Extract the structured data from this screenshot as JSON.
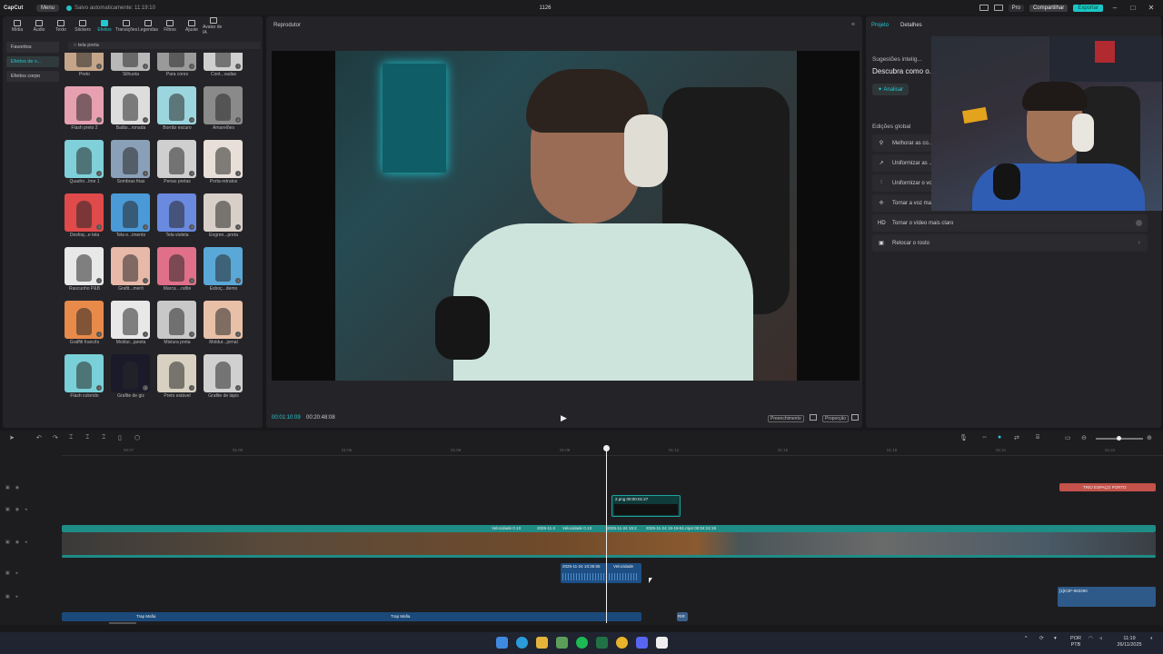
{
  "app": {
    "logo_text": "CapCut",
    "menu_label": "Menu",
    "save_status": "Salvo automaticamente: 11:19:10",
    "project_title": "1126",
    "pro_label": "Pro",
    "share_label": "Compartilhar",
    "export_label": "Exportar",
    "accent_color": "#1bc6c8"
  },
  "toolbar": {
    "tabs": [
      {
        "label": "Mídia",
        "icon": "media-icon"
      },
      {
        "label": "Áudio",
        "icon": "audio-icon"
      },
      {
        "label": "Texto",
        "icon": "text-icon"
      },
      {
        "label": "Stickers",
        "icon": "sticker-icon"
      },
      {
        "label": "Efeitos",
        "icon": "effects-icon",
        "active": true
      },
      {
        "label": "Transições",
        "icon": "transition-icon"
      },
      {
        "label": "Legendas",
        "icon": "captions-icon"
      },
      {
        "label": "Filtros",
        "icon": "filter-icon"
      },
      {
        "label": "Ajuste",
        "icon": "adjust-icon"
      },
      {
        "label": "Avatar de IA",
        "icon": "ai-avatar-icon"
      }
    ]
  },
  "left_panel": {
    "categories": [
      "Favoritos",
      "Efeitos de v...",
      "Efeitos corpo"
    ],
    "search_tag": "tela preta",
    "effects": [
      "Preto",
      "Silhueta",
      "Para cores",
      "Cont...vadas",
      "Flash preto 2",
      "Balão...ronada",
      "Borrão escuro",
      "Amarelões",
      "Quadro...lme 1",
      "Sombras frias",
      "Penas pretas",
      "Porta-retratos",
      "Desfoq...e tela",
      "Tela e...imento",
      "Tela violeta",
      "Engren...preta",
      "Rascunho P&B",
      "Grafit...merô",
      "Marca ...rafite",
      "Esboç...demo",
      "Graffiti francês",
      "Moldur...janela",
      "Mistura preta",
      "Moldur...jornal",
      "Flash colorido",
      "Grafite de giz",
      "Preto estável",
      "Grafite de lápis"
    ]
  },
  "player": {
    "title": "Reprodutor",
    "current_time": "00:01:10:09",
    "total_time": "00:20:48:08",
    "fill_label": "Preenchimento",
    "ratio_label": "Proporção"
  },
  "right_panel": {
    "tab_project": "Projeto",
    "tab_details": "Detalhes",
    "suggest_title": "Sugestões intelig...",
    "suggest_head": "Descubra como o...",
    "analyze_label": "Analisar",
    "global_title": "Edições global",
    "items": [
      {
        "label": "Melhorar as co...",
        "icon": "wand-icon"
      },
      {
        "label": "Uniformizar as ...",
        "icon": "brush-icon"
      },
      {
        "label": "Uniformizar o vo...",
        "icon": "equalizer-icon"
      },
      {
        "label": "Tornar a voz ma...",
        "icon": "sparkle-icon"
      },
      {
        "label": "Tornar o vídeo mais claro",
        "icon": "hd-icon"
      },
      {
        "label": "Retocar o rosto",
        "icon": "face-icon"
      }
    ]
  },
  "timeline": {
    "ruler": [
      "00:07",
      "01:00",
      "01:05",
      "01:06",
      "01:09",
      "01:12",
      "01:15",
      "01:18",
      "01:21",
      "01:24"
    ],
    "clips": {
      "title_overlay": "TRIO ESPAÇO PORTO",
      "sticker_clip": "2.png  00:00:01:27",
      "speed_a": "Velocidade 0.1X",
      "speed_b": "Velocidade 0.1X",
      "main_video": "2025-11-24 15-19-51.mp4  00:04:24:19",
      "date_a": "2025-11-2",
      "date_b": "2025-11-24 15:2",
      "audio_clip": "2025-11-24 10:36:55",
      "audio_speed": "Velocidade",
      "right_audio": "[1]ICB*-963290",
      "music_a": "Trap Mafia",
      "music_b": "Trap Mafia",
      "small_tag": "R!R"
    }
  },
  "taskbar": {
    "lang": "POR",
    "lang2": "PTB",
    "time": "11:19",
    "date": "26/11/2025"
  }
}
